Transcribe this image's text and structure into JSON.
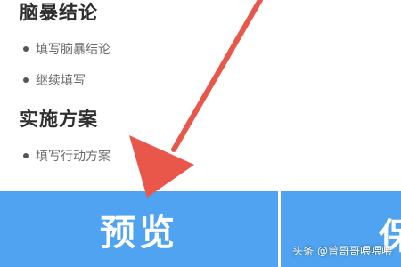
{
  "sections": [
    {
      "title": "脑暴结论",
      "items": [
        "填写脑暴结论",
        "继续填写"
      ]
    },
    {
      "title": "实施方案",
      "items": [
        "填写行动方案"
      ]
    }
  ],
  "bottom_bar": {
    "preview_label": "预览",
    "second_label": "保"
  },
  "watermark": "头条 @曾哥哥喂喂喂",
  "colors": {
    "primary": "#4fa3f0",
    "arrow": "#e9574a"
  },
  "annotation": {
    "icon": "red-arrow-icon"
  }
}
